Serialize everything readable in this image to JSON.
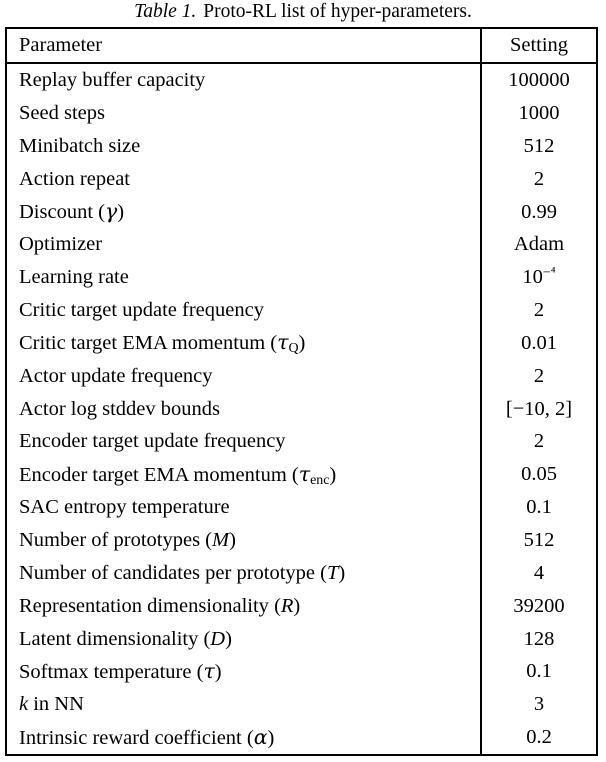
{
  "caption": {
    "label": "Table 1.",
    "text": "Proto-RL list of hyper-parameters."
  },
  "table": {
    "headers": {
      "parameter": "Parameter",
      "setting": "Setting"
    },
    "rows": [
      {
        "parameter": "Replay buffer capacity",
        "setting": "100000"
      },
      {
        "parameter": "Seed steps",
        "setting": "1000"
      },
      {
        "parameter": "Minibatch size",
        "setting": "512"
      },
      {
        "parameter": "Action repeat",
        "setting": "2"
      },
      {
        "parameter": "Discount (γ)",
        "setting": "0.99"
      },
      {
        "parameter": "Optimizer",
        "setting": "Adam"
      },
      {
        "parameter": "Learning rate",
        "setting": "10⁻⁴"
      },
      {
        "parameter": "Critic target update frequency",
        "setting": "2"
      },
      {
        "parameter": "Critic target EMA momentum (τQ)",
        "setting": "0.01"
      },
      {
        "parameter": "Actor update frequency",
        "setting": "2"
      },
      {
        "parameter": "Actor log stddev bounds",
        "setting": "[−10, 2]"
      },
      {
        "parameter": "Encoder target update frequency",
        "setting": "2"
      },
      {
        "parameter": "Encoder target EMA momentum (τenc)",
        "setting": "0.05"
      },
      {
        "parameter": "SAC entropy temperature",
        "setting": "0.1"
      },
      {
        "parameter": "Number of prototypes (M)",
        "setting": "512"
      },
      {
        "parameter": "Number of candidates per prototype (T)",
        "setting": "4"
      },
      {
        "parameter": "Representation dimensionality (R)",
        "setting": "39200"
      },
      {
        "parameter": "Latent dimensionality (D)",
        "setting": "128"
      },
      {
        "parameter": "Softmax temperature (τ)",
        "setting": "0.1"
      },
      {
        "parameter": "k in NN",
        "setting": "3"
      },
      {
        "parameter": "Intrinsic reward coefficient (α)",
        "setting": "0.2"
      }
    ]
  },
  "colors": {
    "text": "#000000",
    "background": "#ffffff",
    "rule": "#000000"
  }
}
